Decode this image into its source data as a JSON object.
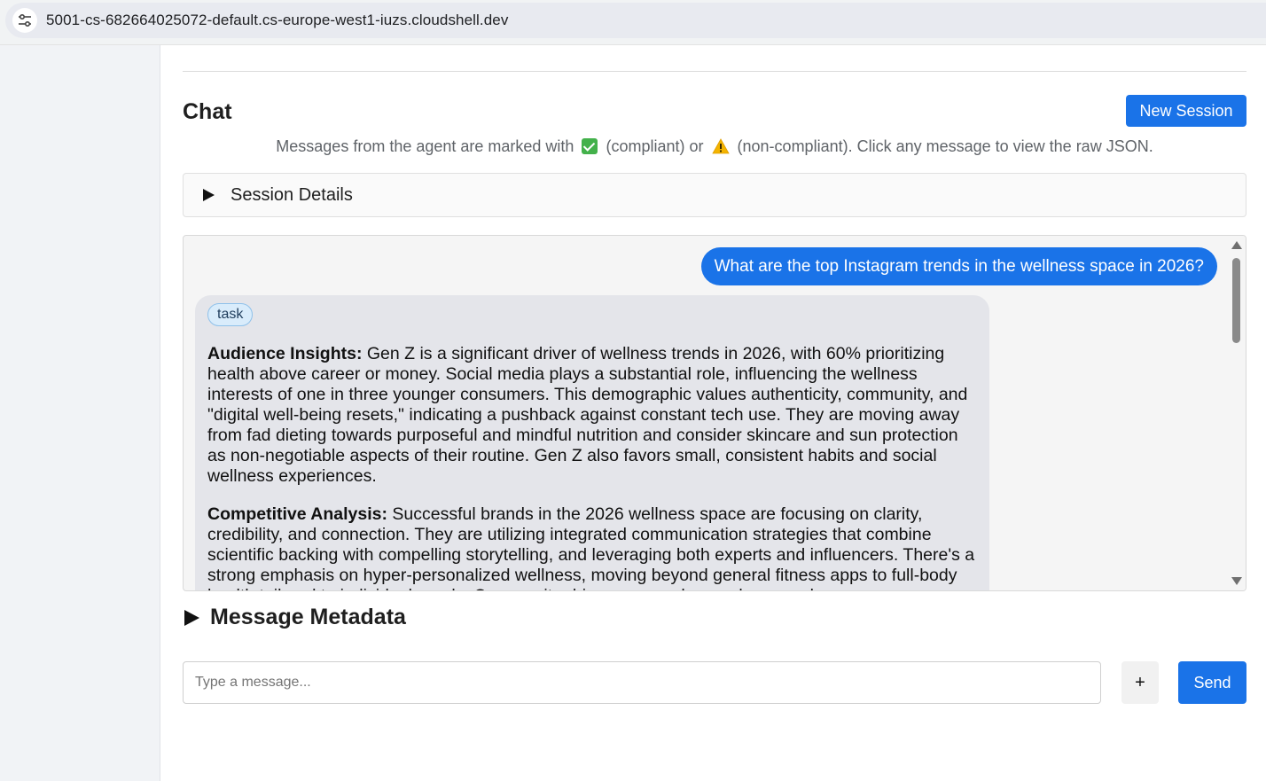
{
  "browser": {
    "url": "5001-cs-682664025072-default.cs-europe-west1-iuzs.cloudshell.dev",
    "site_info_icon": "tune-icon"
  },
  "chat": {
    "title": "Chat",
    "new_session_label": "New Session",
    "legend": {
      "prefix": "Messages from the agent are marked with",
      "compliant": "(compliant) or",
      "noncompliant": "(non-compliant). Click any message to view the raw JSON."
    },
    "session_details_label": "Session Details",
    "messages": {
      "user": "What are the top Instagram trends in the wellness space in 2026?",
      "agent": {
        "badge": "task",
        "paragraphs": [
          {
            "heading": "Audience Insights:",
            "text": " Gen Z is a significant driver of wellness trends in 2026, with 60% prioritizing health above career or money. Social media plays a substantial role, influencing the wellness interests of one in three younger consumers. This demographic values authenticity, community, and \"digital well-being resets,\" indicating a pushback against constant tech use. They are moving away from fad dieting towards purposeful and mindful nutrition and consider skincare and sun protection as non-negotiable aspects of their routine. Gen Z also favors small, consistent habits and social wellness experiences."
          },
          {
            "heading": "Competitive Analysis:",
            "text": " Successful brands in the 2026 wellness space are focusing on clarity, credibility, and connection. They are utilizing integrated communication strategies that combine scientific backing with compelling storytelling, and leveraging both experts and influencers. There's a strong emphasis on hyper-personalized wellness, moving beyond general fitness apps to full-body health tailored to individual needs. Community-driven approaches and personal"
          }
        ]
      }
    },
    "metadata_label": "Message Metadata",
    "input": {
      "placeholder": "Type a message...",
      "value": ""
    },
    "plus_label": "+",
    "send_label": "Send"
  },
  "colors": {
    "accent": "#1a73e8",
    "compliant": "#43b14b",
    "warning": "#f4b400"
  }
}
